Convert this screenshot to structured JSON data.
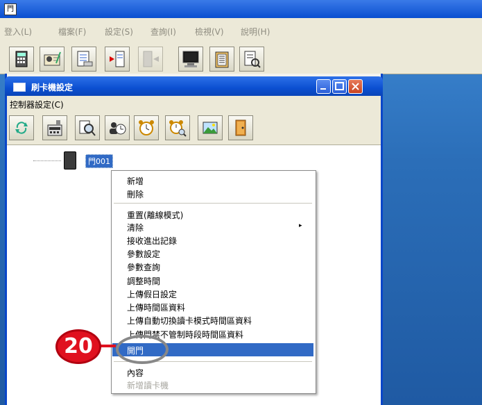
{
  "app": {
    "icon_text": "門"
  },
  "menubar": {
    "items": [
      "登入(L)",
      "檔案(F)",
      "設定(S)",
      "查詢(I)",
      "檢視(V)",
      "說明(H)"
    ]
  },
  "child_window": {
    "title": "刷卡機設定",
    "menu": "控制器設定(C)"
  },
  "tree": {
    "node_label": "門001"
  },
  "context_menu": {
    "group1": [
      "新增",
      "刪除"
    ],
    "group2": [
      "重置(離線模式)",
      "清除",
      "接收進出記錄",
      "參數設定",
      "參數查詢",
      "調整時間",
      "上傳假日設定",
      "上傳時間區資料",
      "上傳自動切換讀卡模式時間區資料",
      "上傳門禁不管制時段時間區資料",
      "開門"
    ],
    "group3": [
      "內容",
      "新增讀卡機"
    ],
    "highlighted": "開門",
    "submenu_arrow": "▸"
  },
  "annotation": {
    "badge_number": "20",
    "badge_color": "#e0111f"
  },
  "colors": {
    "accent": "#316ac5",
    "titlebar": "#0a4fd0",
    "chrome": "#ece9d8"
  }
}
